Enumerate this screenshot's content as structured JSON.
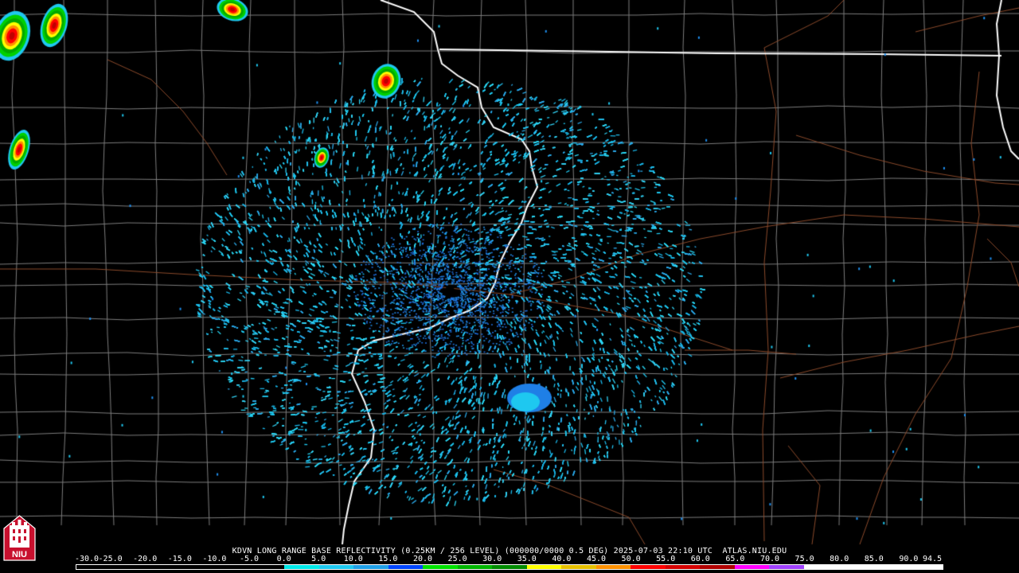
{
  "product_caption": "KDVN LONG RANGE BASE REFLECTIVITY (0.25KM / 256 LEVEL) (000000/0000 0.5 DEG) 2025-07-03 22:10 UTC  ATLAS.NIU.EDU",
  "logo_text": "NIU",
  "scale": {
    "labels": [
      "-30.0",
      "-25.0",
      "-20.0",
      "-15.0",
      "-10.0",
      "-5.0",
      "0.0",
      "5.0",
      "10.0",
      "15.0",
      "20.0",
      "25.0",
      "30.0",
      "35.0",
      "40.0",
      "45.0",
      "50.0",
      "55.0",
      "60.0",
      "65.0",
      "70.0",
      "75.0",
      "80.0",
      "85.0",
      "90.0",
      "94.5"
    ],
    "colors": [
      "#000000",
      "#000000",
      "#000000",
      "#000000",
      "#000000",
      "#000000",
      "#00e8e8",
      "#1ec8f0",
      "#1f9fe6",
      "#0044ff",
      "#00e000",
      "#00b400",
      "#008a00",
      "#ffff00",
      "#e6c000",
      "#ff9000",
      "#ff0000",
      "#d40000",
      "#b00000",
      "#ff00ff",
      "#a040ff",
      "#ffffff",
      "#ffffff",
      "#ffffff",
      "#ffffff"
    ]
  },
  "colors": {
    "background": "#000000",
    "county_lines": "#7d7d7d",
    "state_lines": "#ffffff",
    "highways": "#8b4a2b",
    "radar_site": "#000000"
  },
  "radar": {
    "site": "KDVN",
    "echo_levels_dbz": [
      0,
      5,
      10,
      15,
      20,
      25,
      30,
      35,
      40,
      45,
      50,
      55,
      60
    ]
  }
}
